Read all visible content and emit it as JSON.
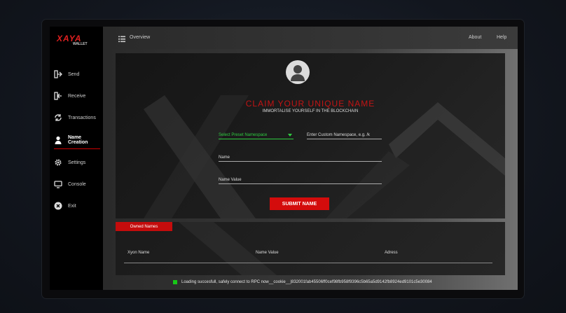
{
  "app": {
    "logo_text": "XAYA",
    "logo_sub": "WALLET"
  },
  "sidebar": {
    "items": [
      {
        "label": "Send",
        "icon": "send-icon"
      },
      {
        "label": "Receive",
        "icon": "receive-icon"
      },
      {
        "label": "Transactions",
        "icon": "transactions-icon"
      },
      {
        "label": "Name Creation",
        "icon": "user-icon"
      },
      {
        "label": "Settings",
        "icon": "gear-icon"
      },
      {
        "label": "Console",
        "icon": "console-icon"
      },
      {
        "label": "Exit",
        "icon": "close-icon"
      }
    ],
    "active_index": 3
  },
  "topbar": {
    "overview_label": "Overview",
    "about_label": "About",
    "help_label": "Help"
  },
  "claim": {
    "title": "CLAIM YOUR UNIQUE NAME",
    "subtitle": "IMMORTALISE YOURSELF IN THE BLOCKCHAIN",
    "preset_namespace_label": "Select Preset Namespace",
    "custom_namespace_label": "Enter Custom Namespace, e.g. /k",
    "name_label": "Name",
    "name_value_label": "Name Value",
    "submit_label": "SUBMIT NAME"
  },
  "owned_names": {
    "tab_label": "Owned Names",
    "columns": [
      "Xyon Name",
      "Name Value",
      "Adress"
    ]
  },
  "status": {
    "text": "Loading succesfull, safely connect to RPC now__cookie__|832001fab45506ff0cef98fb958f9396c5b65a5d9142fb8924ed9101c5e30084",
    "color": "#17c817"
  },
  "colors": {
    "accent": "#d40c0c",
    "success": "#2ecc40"
  }
}
